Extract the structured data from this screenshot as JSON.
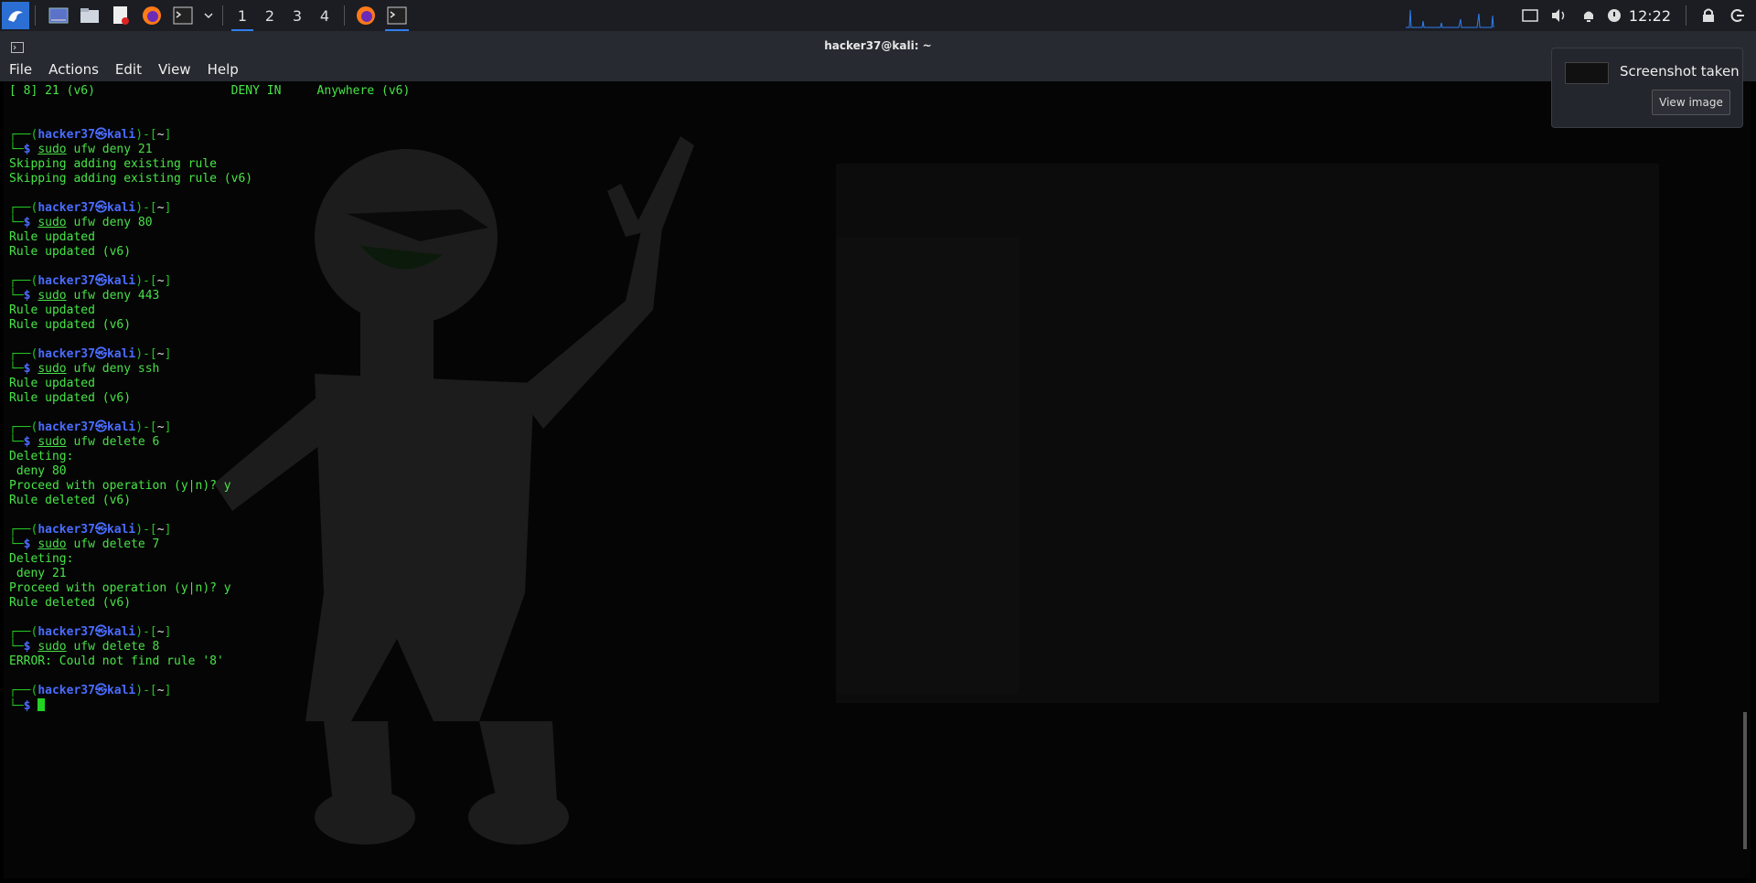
{
  "panel": {
    "workspaces": [
      "1",
      "2",
      "3",
      "4"
    ],
    "active_workspace": "1",
    "clock": "12:22",
    "icons": [
      "kali-menu-icon",
      "desktop-icon",
      "file-manager-icon",
      "text-editor-icon",
      "firefox-icon",
      "terminal-icon",
      "chevron-down-icon"
    ]
  },
  "window": {
    "title": "hacker37@kali: ~",
    "menu": [
      "File",
      "Actions",
      "Edit",
      "View",
      "Help"
    ]
  },
  "terminal": {
    "user": "hacker37",
    "host": "kali",
    "lines": [
      {
        "t": "out",
        "text": "[ 8] 21 (v6)                   DENY IN     Anywhere (v6)"
      },
      {
        "t": "blank"
      },
      {
        "t": "blank"
      },
      {
        "t": "prompt"
      },
      {
        "t": "cmd",
        "sudo": "sudo",
        "rest": " ufw deny 21"
      },
      {
        "t": "out",
        "text": "Skipping adding existing rule"
      },
      {
        "t": "out",
        "text": "Skipping adding existing rule (v6)"
      },
      {
        "t": "blank"
      },
      {
        "t": "prompt"
      },
      {
        "t": "cmd",
        "sudo": "sudo",
        "rest": " ufw deny 80"
      },
      {
        "t": "out",
        "text": "Rule updated"
      },
      {
        "t": "out",
        "text": "Rule updated (v6)"
      },
      {
        "t": "blank"
      },
      {
        "t": "prompt"
      },
      {
        "t": "cmd",
        "sudo": "sudo",
        "rest": " ufw deny 443"
      },
      {
        "t": "out",
        "text": "Rule updated"
      },
      {
        "t": "out",
        "text": "Rule updated (v6)"
      },
      {
        "t": "blank"
      },
      {
        "t": "prompt"
      },
      {
        "t": "cmd",
        "sudo": "sudo",
        "rest": " ufw deny ssh"
      },
      {
        "t": "out",
        "text": "Rule updated"
      },
      {
        "t": "out",
        "text": "Rule updated (v6)"
      },
      {
        "t": "blank"
      },
      {
        "t": "prompt"
      },
      {
        "t": "cmd",
        "sudo": "sudo",
        "rest": " ufw delete 6"
      },
      {
        "t": "out",
        "text": "Deleting:"
      },
      {
        "t": "out",
        "text": " deny 80"
      },
      {
        "t": "out",
        "text": "Proceed with operation (y|n)? y"
      },
      {
        "t": "out",
        "text": "Rule deleted (v6)"
      },
      {
        "t": "blank"
      },
      {
        "t": "prompt"
      },
      {
        "t": "cmd",
        "sudo": "sudo",
        "rest": " ufw delete 7"
      },
      {
        "t": "out",
        "text": "Deleting:"
      },
      {
        "t": "out",
        "text": " deny 21"
      },
      {
        "t": "out",
        "text": "Proceed with operation (y|n)? y"
      },
      {
        "t": "out",
        "text": "Rule deleted (v6)"
      },
      {
        "t": "blank"
      },
      {
        "t": "prompt"
      },
      {
        "t": "cmd",
        "sudo": "sudo",
        "rest": " ufw delete 8"
      },
      {
        "t": "out",
        "text": "ERROR: Could not find rule '8'"
      },
      {
        "t": "blank"
      },
      {
        "t": "prompt"
      },
      {
        "t": "cursor"
      }
    ]
  },
  "notification": {
    "title": "Screenshot taken",
    "button": "View image"
  },
  "colors": {
    "prompt_green": "#22c322",
    "user_blue": "#4a6cff",
    "accent": "#2f7ef0",
    "terminal_bg": "#050505"
  }
}
